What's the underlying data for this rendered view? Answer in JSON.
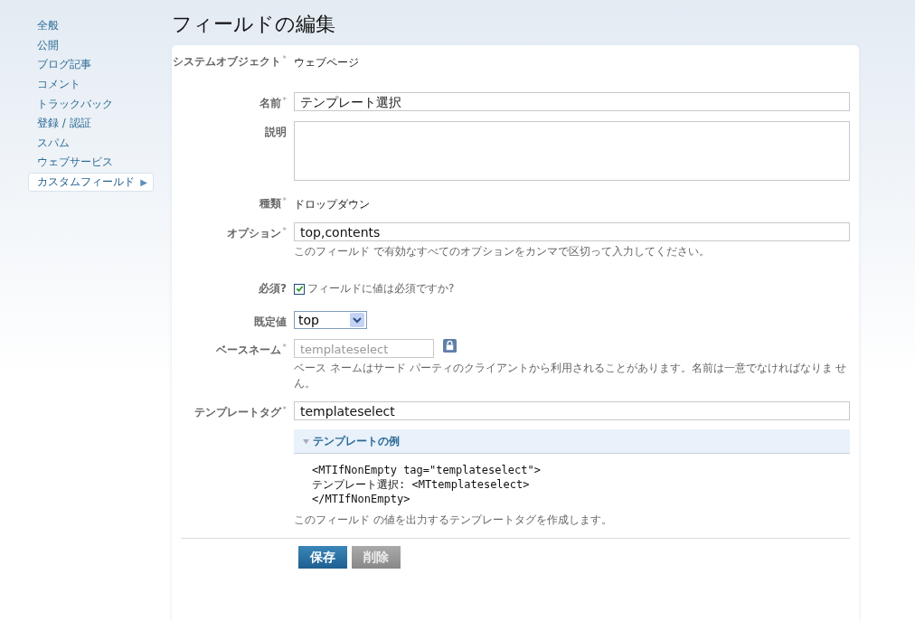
{
  "sidebar": {
    "items": [
      {
        "label": "全般",
        "selected": false
      },
      {
        "label": "公開",
        "selected": false
      },
      {
        "label": "ブログ記事",
        "selected": false
      },
      {
        "label": "コメント",
        "selected": false
      },
      {
        "label": "トラックバック",
        "selected": false
      },
      {
        "label": "登録 / 認証",
        "selected": false
      },
      {
        "label": "スパム",
        "selected": false
      },
      {
        "label": "ウェブサービス",
        "selected": false
      },
      {
        "label": "カスタムフィールド",
        "selected": true,
        "arrow": "▶"
      }
    ]
  },
  "page_title": "フィールドの編集",
  "fields": [
    {
      "kind": "static",
      "label": "システムオブジェクト",
      "mark": "*",
      "value": "ウェブページ"
    },
    {
      "kind": "input",
      "label": "名前",
      "mark": "*",
      "value": "テンプレート選択"
    },
    {
      "kind": "textarea",
      "label": "説明"
    },
    {
      "kind": "static",
      "label": "種類",
      "mark": "*",
      "value": "ドロップダウン"
    },
    {
      "kind": "input",
      "label": "オプション",
      "mark": "*",
      "value": "top,contents",
      "hint": "このフィールド で有効なすべてのオプションをカンマで区切って入力してください。"
    },
    {
      "kind": "checkbox",
      "label": "必須?",
      "checked": true,
      "text": "フィールドに値は必須ですか?"
    },
    {
      "kind": "select",
      "label": "既定値",
      "value": "top"
    },
    {
      "kind": "locked",
      "label": "ベースネーム",
      "mark": "*",
      "value": "templateselect",
      "hint": "ベース ネームはサード パーティのクライアントから利用されることがあります。名前は一意でなければなりま せん。"
    },
    {
      "kind": "input",
      "label": "テンプレートタグ",
      "mark": "*",
      "value": "templateselect",
      "example": {
        "title": "テンプレートの例",
        "expanded": true,
        "lines": [
          "<MTIfNonEmpty tag=\"templateselect\">",
          "テンプレート選択: <MTtemplateselect>",
          "</MTIfNonEmpty>"
        ]
      },
      "hint": "このフィールド の値を出力するテンプレートタグを作成します。"
    }
  ],
  "buttons": [
    {
      "label": "保存",
      "kind": "primary"
    },
    {
      "label": "削除",
      "kind": "secondary"
    }
  ]
}
